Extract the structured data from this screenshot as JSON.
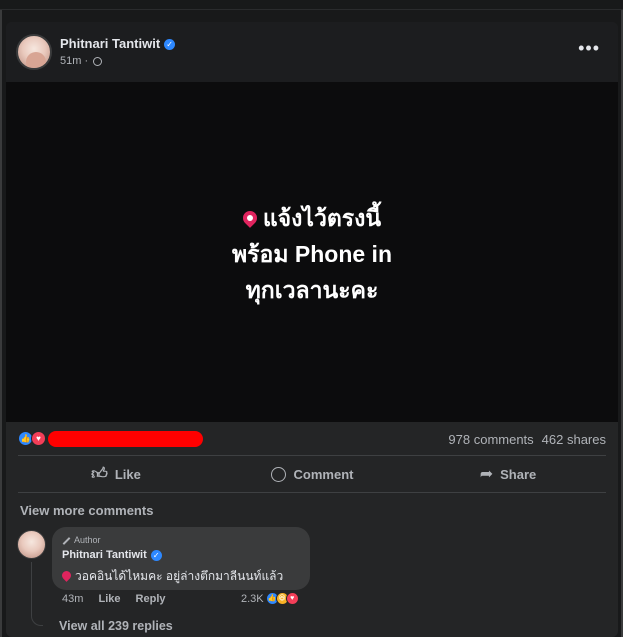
{
  "post": {
    "author": "Phitnari Tantiwit",
    "time": "51m ·",
    "image_text_lines": [
      "แจ้งไว้ตรงนี้",
      "พร้อม Phone in",
      "ทุกเวลานะคะ"
    ],
    "comments_count": "978 comments",
    "shares_count": "462 shares"
  },
  "actions": {
    "like": "Like",
    "comment": "Comment",
    "share": "Share"
  },
  "comments": {
    "view_more": "View more comments",
    "item": {
      "badge": "Author",
      "name": "Phitnari Tantiwit",
      "text": "วอคอินได้ไหมคะ อยู่ล่างตึกมาลีนนท์แล้ว",
      "time": "43m",
      "like": "Like",
      "reply": "Reply",
      "reactions": "2.3K"
    },
    "view_replies": "View all 239 replies"
  },
  "icons": [
    "verified-icon",
    "globe-icon",
    "more-icon",
    "pin-icon",
    "like-icon",
    "comment-icon",
    "share-icon",
    "pencil-icon"
  ],
  "colors": {
    "redaction": "#ff0000",
    "like_blue": "#2d88ff",
    "love_red": "#f33e58"
  }
}
